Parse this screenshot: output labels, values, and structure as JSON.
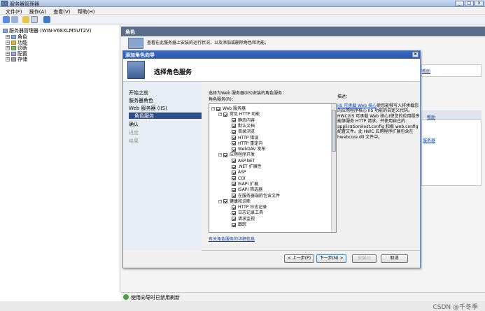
{
  "window": {
    "title": "服务器管理器"
  },
  "menu": [
    "文件(F)",
    "操作(A)",
    "查看(V)",
    "帮助(H)"
  ],
  "tree": {
    "root": "服务器管理器 (WIN-V68XLM5UT2V)",
    "items": [
      "角色",
      "功能",
      "诊断",
      "配置",
      "存储"
    ]
  },
  "right_pane": {
    "header": "角色",
    "partial_text": "查看在此服务器上安装的运行状况，以及添加或删除角色和功能。",
    "help_link_1": "帮助",
    "help_link_2": "帮助",
    "server_link": "服务器"
  },
  "status_bar": {
    "text": "使用向导时已禁用刷新"
  },
  "dialog": {
    "title": "添加角色向导",
    "heading": "选择角色服务",
    "steps": [
      {
        "label": "开始之前",
        "state": "normal"
      },
      {
        "label": "服务器角色",
        "state": "normal"
      },
      {
        "label": "Web 服务器 (IIS)",
        "state": "normal"
      },
      {
        "label": "角色服务",
        "state": "active"
      },
      {
        "label": "确认",
        "state": "normal"
      },
      {
        "label": "进度",
        "state": "disabled"
      },
      {
        "label": "结果",
        "state": "disabled"
      }
    ],
    "instruction": "选择为Web 服务器(IIS)安装的角色服务：",
    "list_label": "角色服务(R)：",
    "role_services": [
      {
        "label": "Web 服务器",
        "level": 0,
        "checked": true,
        "toggle": "⊟"
      },
      {
        "label": "常见 HTTP 功能",
        "level": 1,
        "checked": true,
        "toggle": "⊟"
      },
      {
        "label": "静态内容",
        "level": 2,
        "checked": true
      },
      {
        "label": "默认文档",
        "level": 2,
        "checked": true
      },
      {
        "label": "目录浏览",
        "level": 2,
        "checked": true
      },
      {
        "label": "HTTP 错误",
        "level": 2,
        "checked": true
      },
      {
        "label": "HTTP 重定向",
        "level": 2,
        "checked": true
      },
      {
        "label": "WebDAV 发布",
        "level": 2,
        "checked": true
      },
      {
        "label": "应用程序开发",
        "level": 1,
        "checked": true,
        "toggle": "⊟"
      },
      {
        "label": "ASP.NET",
        "level": 2,
        "checked": true
      },
      {
        "label": ".NET 扩展性",
        "level": 2,
        "checked": true
      },
      {
        "label": "ASP",
        "level": 2,
        "checked": true
      },
      {
        "label": "CGI",
        "level": 2,
        "checked": true
      },
      {
        "label": "ISAPI 扩展",
        "level": 2,
        "checked": true
      },
      {
        "label": "ISAPI 筛选器",
        "level": 2,
        "checked": true
      },
      {
        "label": "在服务器端的包含文件",
        "level": 2,
        "checked": true
      },
      {
        "label": "健康和诊断",
        "level": 1,
        "checked": true,
        "toggle": "⊟"
      },
      {
        "label": "HTTP 日志记录",
        "level": 2,
        "checked": true
      },
      {
        "label": "日志记录工具",
        "level": 2,
        "checked": true
      },
      {
        "label": "请求监视",
        "level": 2,
        "checked": true
      },
      {
        "label": "跟踪",
        "level": 2,
        "checked": true
      }
    ],
    "description_label": "描述：",
    "description_link": "IIS 可承载 Web 核心",
    "description_text": "使您能够写入将承载您的应用程序核心 IIS 功能的自定义代码。HWC(IIS 可承载 Web 核心)使您的应用程序能够服务 HTTP 请求，并使用自己的 applicationHost.config 和根 web.config 配置文件。此 HWC 应用程序扩展包含在 hwebcore.dll 文件中。",
    "more_info_link": "有关角色服务的详细信息",
    "buttons": {
      "back": "< 上一步(P)",
      "next": "下一步(N) >",
      "install": "安装(I)",
      "cancel": "取消"
    }
  },
  "watermark": "CSDN @千冬季"
}
